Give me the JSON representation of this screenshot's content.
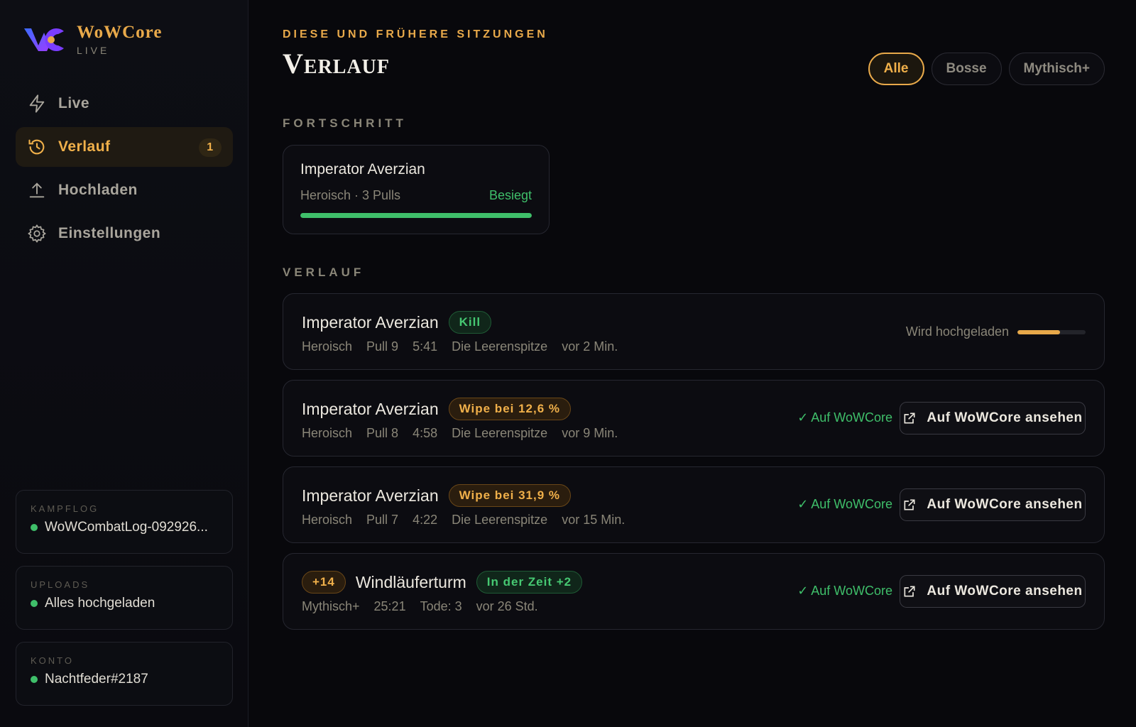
{
  "brand": {
    "name": "WoWCore",
    "sub": "LIVE"
  },
  "nav": [
    {
      "label": "Live",
      "icon": "bolt-icon"
    },
    {
      "label": "Verlauf",
      "icon": "history-icon",
      "badge": "1",
      "active": true
    },
    {
      "label": "Hochladen",
      "icon": "upload-icon"
    },
    {
      "label": "Einstellungen",
      "icon": "gear-icon"
    }
  ],
  "info": {
    "combatlog": {
      "label": "KAMPFLOG",
      "value": "WoWCombatLog-092926..."
    },
    "uploads": {
      "label": "UPLOADS",
      "value": "Alles hochgeladen"
    },
    "account": {
      "label": "KONTO",
      "value": "Nachtfeder#2187"
    }
  },
  "header": {
    "eyebrow": "DIESE UND FRÜHERE SITZUNGEN",
    "title": "Verlauf"
  },
  "filters": [
    "Alle",
    "Bosse",
    "Mythisch+"
  ],
  "sections": {
    "progress": "FORTSCHRITT",
    "history": "VERLAUF"
  },
  "progress": {
    "boss": "Imperator Averzian",
    "meta": "Heroisch · 3 Pulls",
    "status": "Besiegt",
    "fraction": 1.0
  },
  "rows": [
    {
      "name": "Imperator Averzian",
      "tag": "Kill",
      "meta": [
        "Heroisch",
        "Pull 9",
        "5:41",
        "Die Leerenspitze",
        "vor 2 Min."
      ],
      "uploading_label": "Wird hochgeladen",
      "upload_fraction": 0.62
    },
    {
      "name": "Imperator Averzian",
      "tag": "Wipe bei 12,6 %",
      "meta": [
        "Heroisch",
        "Pull 8",
        "4:58",
        "Die Leerenspitze",
        "vor 9 Min."
      ],
      "onwow": "✓ Auf WoWCore",
      "button": "Auf WoWCore ansehen"
    },
    {
      "name": "Imperator Averzian",
      "tag": "Wipe bei 31,9 %",
      "meta": [
        "Heroisch",
        "Pull 7",
        "4:22",
        "Die Leerenspitze",
        "vor 15 Min."
      ],
      "onwow": "✓ Auf WoWCore",
      "button": "Auf WoWCore ansehen"
    },
    {
      "level": "+14",
      "name": "Windläuferturm",
      "tag": "In der Zeit +2",
      "meta": [
        "Mythisch+",
        "25:21",
        "Tode: 3",
        "vor 26 Std."
      ],
      "onwow": "✓ Auf WoWCore",
      "button": "Auf WoWCore ansehen"
    }
  ],
  "colors": {
    "accent": "#e8a94a",
    "success": "#3fbf6a",
    "background": "#08080c"
  }
}
